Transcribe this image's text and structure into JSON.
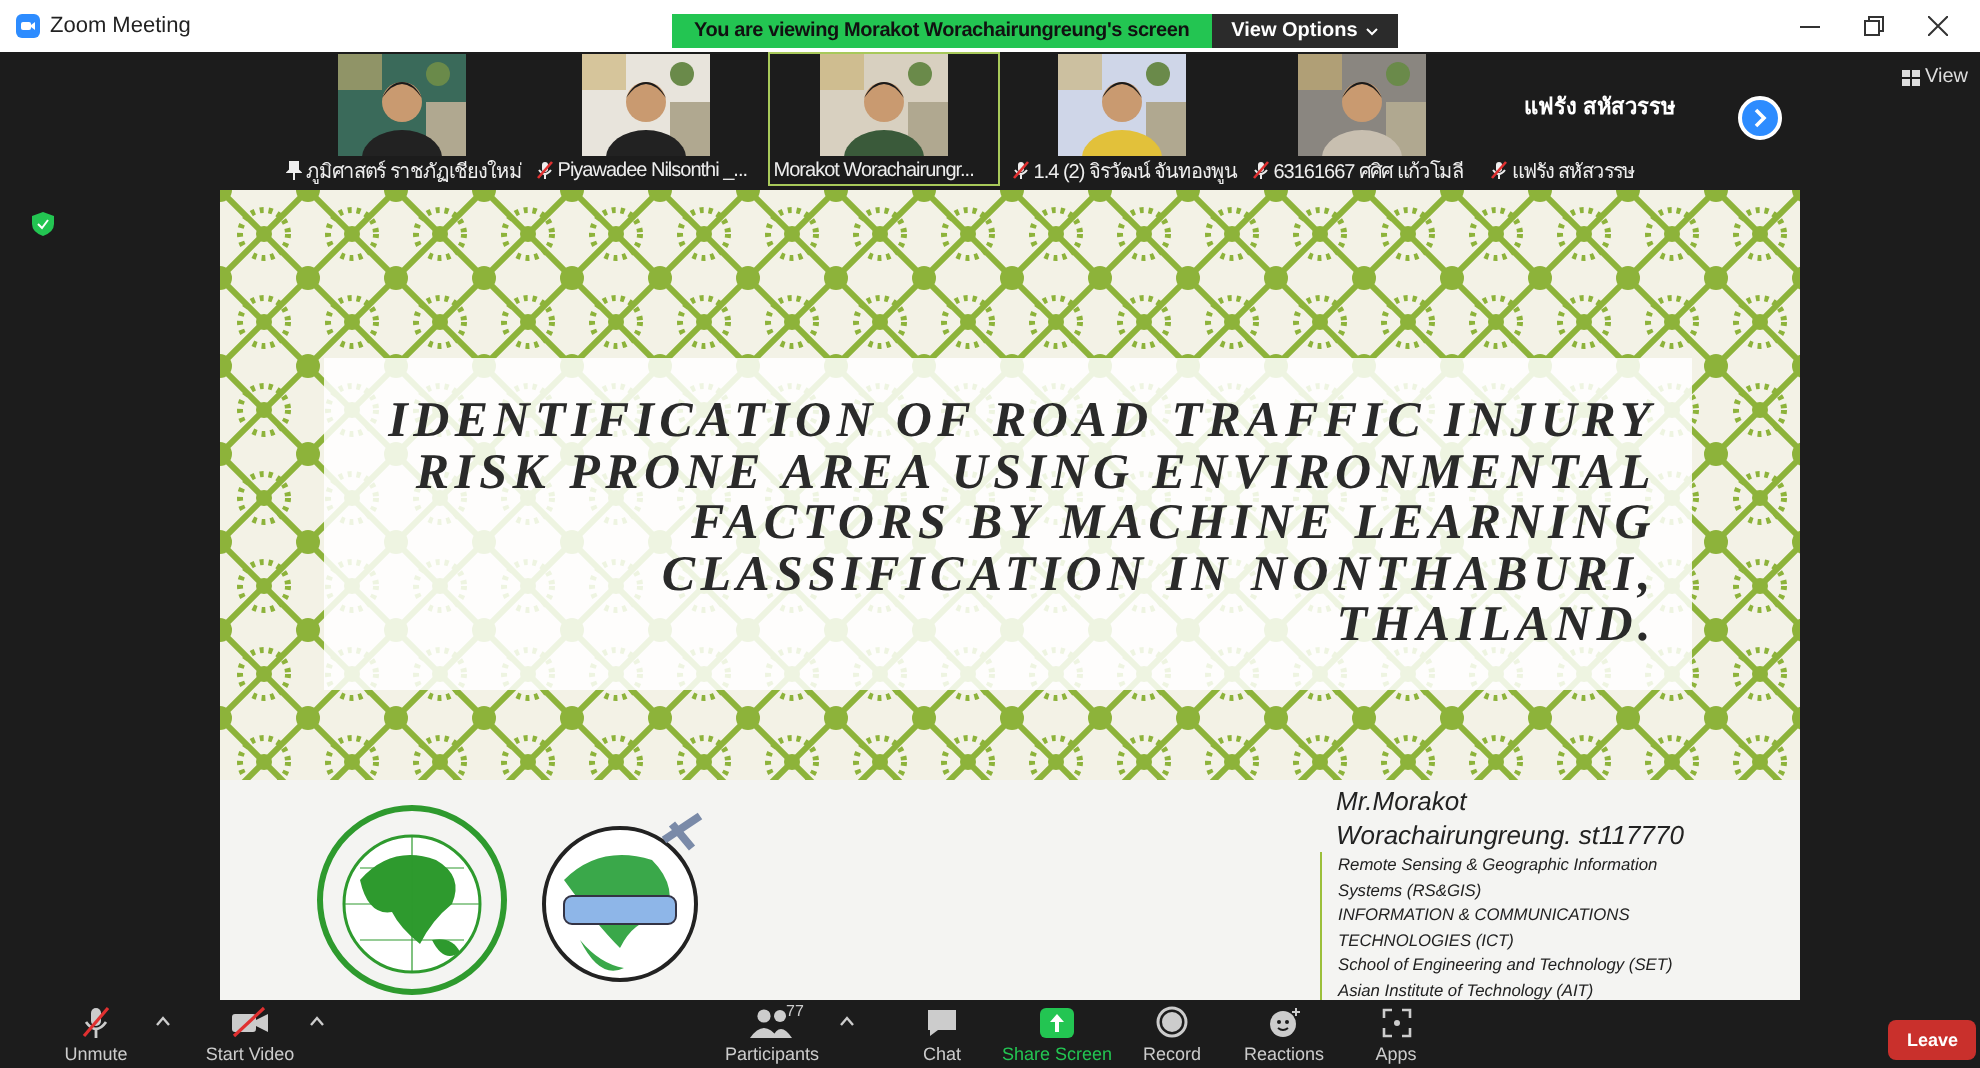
{
  "window": {
    "title": "Zoom Meeting"
  },
  "banner": {
    "text": "You are viewing Morakot Worachairungreung's screen",
    "button": "View Options"
  },
  "view_button": "View",
  "participants": [
    {
      "kind": "video",
      "name": "ภูมิศาสตร์ ราชภัฏเชียงใหม่",
      "muted": false,
      "speaking": false
    },
    {
      "kind": "video",
      "name": "Piyawadee Nilsonthi _...",
      "muted": true,
      "speaking": false
    },
    {
      "kind": "video",
      "name": "Morakot Worachairungr...",
      "muted": false,
      "speaking": true
    },
    {
      "kind": "video",
      "name": "1.4 (2) จิรวัฒน์ จันทองพูน",
      "muted": true,
      "speaking": false
    },
    {
      "kind": "video",
      "name": "63161667 ศศิศ แก้วโมลี",
      "muted": true,
      "speaking": false
    },
    {
      "kind": "name",
      "name": "แฟรัง สหัสวรรษ",
      "display": "แฟรัง สหัสวรรษ",
      "muted": true,
      "speaking": false
    }
  ],
  "slide": {
    "title": "IDENTIFICATION OF ROAD TRAFFIC INJURY RISK PRONE AREA USING ENVIRONMENTAL FACTORS BY MACHINE LEARNING CLASSIFICATION IN NONTHABURI, THAILAND.",
    "presenter": [
      "Mr.Morakot",
      "Worachairungreung. st117770"
    ],
    "details": [
      "Remote Sensing & Geographic Information Systems (RS&GIS)",
      "INFORMATION & COMMUNICATIONS TECHNOLOGIES (ICT)",
      "School of Engineering and Technology (SET)",
      "Asian Institute of Technology (AIT)"
    ]
  },
  "toolbar_left": [
    {
      "kind": "mic",
      "label": "Unmute",
      "caret": true
    },
    {
      "kind": "video",
      "label": "Start Video",
      "caret": true
    }
  ],
  "toolbar_center": [
    {
      "kind": "participants",
      "label": "Participants",
      "count": "77",
      "caret": true,
      "highlight": false
    },
    {
      "kind": "chat",
      "label": "Chat",
      "highlight": false
    },
    {
      "kind": "share",
      "label": "Share Screen",
      "highlight": true
    },
    {
      "kind": "record",
      "label": "Record",
      "highlight": false
    },
    {
      "kind": "reactions",
      "label": "Reactions",
      "highlight": false
    },
    {
      "kind": "apps",
      "label": "Apps",
      "highlight": false
    }
  ],
  "leave_button": "Leave"
}
